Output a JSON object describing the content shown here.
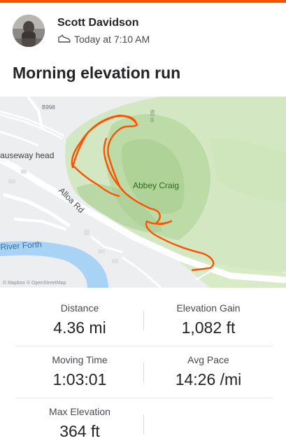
{
  "activity": {
    "athlete_name": "Scott Davidson",
    "timestamp": "Today at 7:10 AM",
    "title": "Morning elevation run",
    "sport_icon": "shoe-icon",
    "accent_color": "#fc5200"
  },
  "map": {
    "labels": {
      "causewayhead": "auseway head",
      "alloa_rd": "Alloa Rd",
      "abbey_craig": "Abbey Craig",
      "river_forth": "River Forth",
      "road_code": "B998",
      "contour": "60 m",
      "attribution": "© Mapbox © OpenStreetMap"
    },
    "route_color": "#fc5200",
    "water_color": "#a9d3f4",
    "park_color": "#c9e3b6"
  },
  "stats": {
    "distance_label": "Distance",
    "distance_value": "4.36 mi",
    "elevation_gain_label": "Elevation Gain",
    "elevation_gain_value": "1,082 ft",
    "moving_time_label": "Moving Time",
    "moving_time_value": "1:03:01",
    "avg_pace_label": "Avg Pace",
    "avg_pace_value": "14:26 /mi",
    "max_elevation_label": "Max Elevation",
    "max_elevation_value": "364 ft"
  }
}
